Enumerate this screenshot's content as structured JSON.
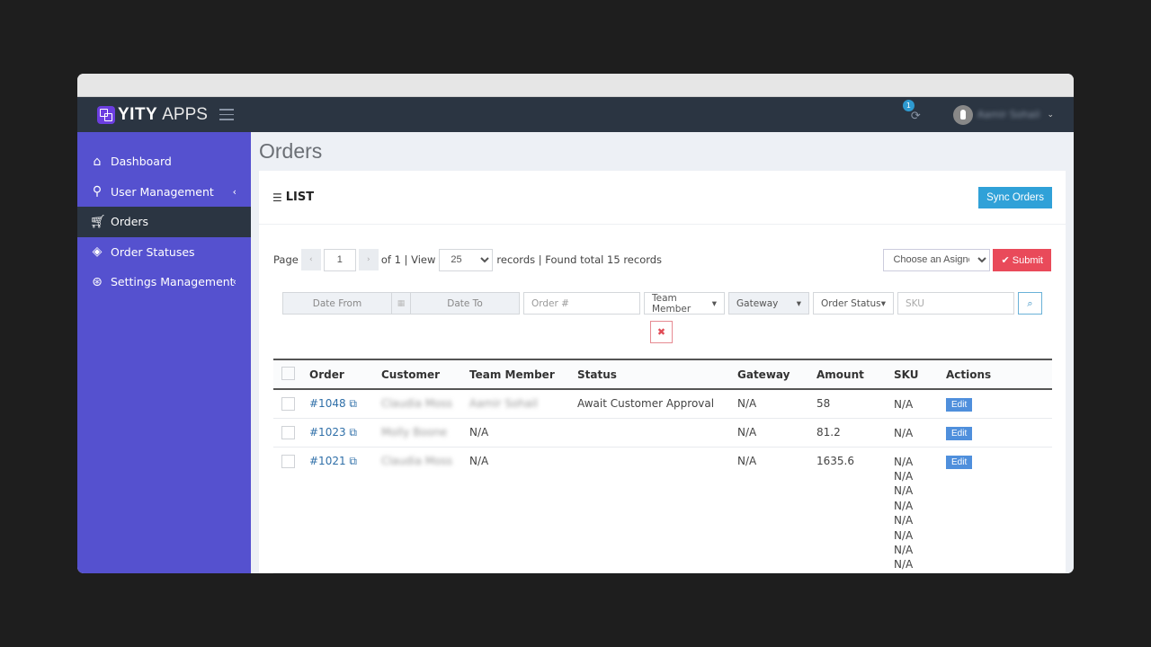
{
  "app": {
    "logo_bold": "YITY",
    "logo_light": "APPS",
    "notification_count": "1",
    "username": "Aamir Sohail"
  },
  "sidebar": {
    "items": [
      {
        "label": "Dashboard",
        "icon": "home-icon",
        "has_submenu": false,
        "active": false
      },
      {
        "label": "User Management",
        "icon": "user-icon",
        "has_submenu": true,
        "active": false
      },
      {
        "label": "Orders",
        "icon": "cart-icon",
        "has_submenu": false,
        "active": true
      },
      {
        "label": "Order Statuses",
        "icon": "tags-icon",
        "has_submenu": false,
        "active": false
      },
      {
        "label": "Settings Management",
        "icon": "lifebuoy-icon",
        "has_submenu": true,
        "active": false
      }
    ]
  },
  "page": {
    "title": "Orders",
    "card_title": "LIST",
    "sync_button": "Sync Orders"
  },
  "pagination": {
    "page_label": "Page",
    "prev": "‹",
    "current_page": "1",
    "next": "›",
    "of_text": "of 1 | View",
    "per_page": "25",
    "records_text": "records | Found total 15 records"
  },
  "assign": {
    "placeholder": "Choose an Asignee",
    "submit_label": "Submit"
  },
  "filters": {
    "date_from": "Date From",
    "date_to": "Date To",
    "order_no": "Order #",
    "team_member": "Team Member",
    "gateway": "Gateway",
    "order_status": "Order Status",
    "sku": "SKU"
  },
  "table": {
    "columns": [
      "Order",
      "Customer",
      "Team Member",
      "Status",
      "Gateway",
      "Amount",
      "SKU",
      "Actions"
    ],
    "rows": [
      {
        "order": "#1048",
        "customer": "Claudia Moss",
        "team_member": "Aamir Sohail",
        "team_member_blurred": true,
        "status": "Await Customer Approval",
        "gateway": "N/A",
        "amount": "58",
        "sku": [
          "N/A"
        ],
        "action": "Edit"
      },
      {
        "order": "#1023",
        "customer": "Molly Boone",
        "team_member": "N/A",
        "team_member_blurred": false,
        "status": "",
        "gateway": "N/A",
        "amount": "81.2",
        "sku": [
          "N/A"
        ],
        "action": "Edit"
      },
      {
        "order": "#1021",
        "customer": "Claudia Moss",
        "team_member": "N/A",
        "team_member_blurred": false,
        "status": "",
        "gateway": "N/A",
        "amount": "1635.6",
        "sku": [
          "N/A",
          "N/A",
          "N/A",
          "N/A",
          "N/A",
          "N/A",
          "N/A",
          "N/A"
        ],
        "action": "Edit"
      }
    ]
  }
}
